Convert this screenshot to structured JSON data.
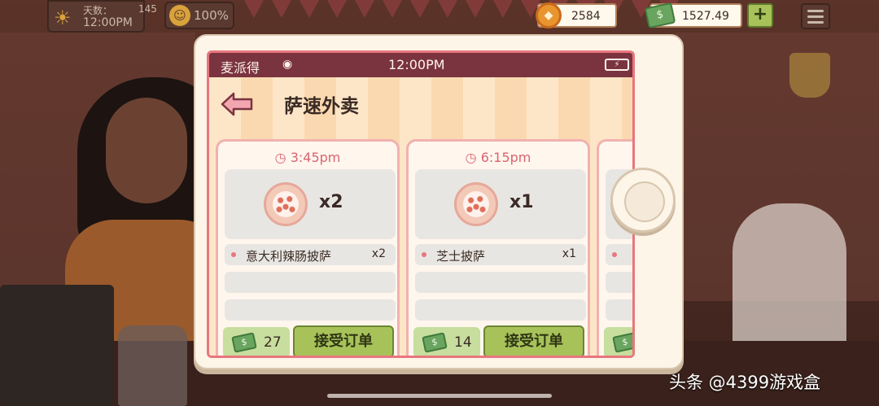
{
  "hud": {
    "day_label": "天数：",
    "day_number": "145",
    "time": "12:00PM",
    "mood_percent": "100%",
    "coins": "2584",
    "cash": "1527.49",
    "add_label": "+"
  },
  "tablet": {
    "status": {
      "carrier": "麦派得",
      "clock": "12:00PM"
    },
    "app_title": "萨速外卖",
    "orders": [
      {
        "time": "3:45pm",
        "quantity": "x2",
        "items": [
          {
            "name": "意大利辣肠披萨",
            "count": "x2"
          }
        ],
        "reward": "27",
        "accept_label": "接受订单"
      },
      {
        "time": "6:15pm",
        "quantity": "x1",
        "items": [
          {
            "name": "芝士披萨",
            "count": "x1"
          }
        ],
        "reward": "14",
        "accept_label": "接受订单"
      }
    ]
  },
  "watermark": "头条 @4399游戏盒",
  "colors": {
    "accent_pink": "#e8767e",
    "status_bar": "#7a3440",
    "accept_green": "#a8c25a"
  }
}
